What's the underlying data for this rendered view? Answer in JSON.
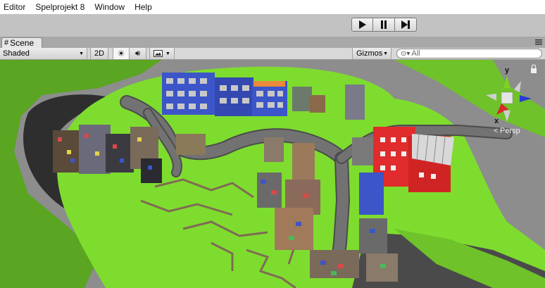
{
  "menubar": {
    "items": [
      "Editor",
      "Spelprojekt 8",
      "Window",
      "Help"
    ]
  },
  "playback": {
    "play": "play-icon",
    "pause": "pause-icon",
    "step": "step-icon"
  },
  "tab": {
    "label": "Scene",
    "icon": "grid-icon"
  },
  "scene_toolbar": {
    "draw_mode": "Shaded",
    "mode_2d": "2D",
    "gizmos": "Gizmos",
    "search_placeholder": "All"
  },
  "gizmo": {
    "y": "y",
    "x": "x",
    "persp": "Persp"
  },
  "colors": {
    "grass": "#7ddb2e",
    "grass_dark": "#4e9418",
    "road": "#6f6f6f",
    "void": "#3a3a3a",
    "sky": "#8c8c8c",
    "building_blue": "#3c55c8",
    "building_red": "#e23030"
  }
}
